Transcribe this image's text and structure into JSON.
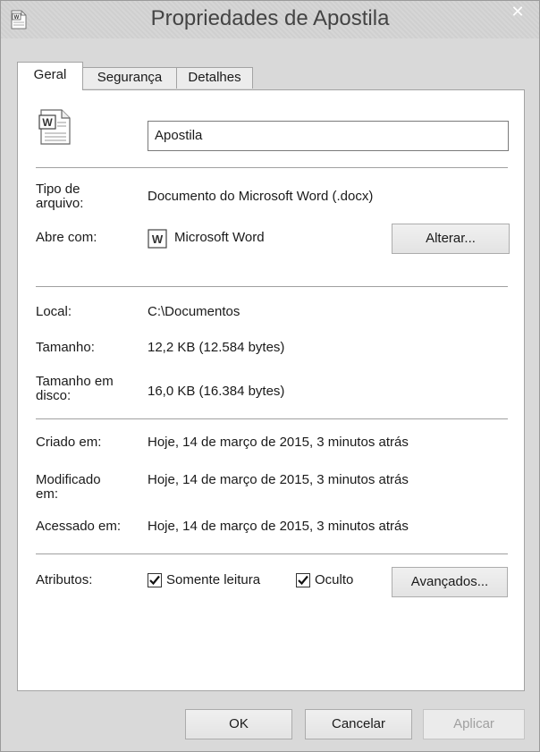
{
  "window": {
    "title": "Propriedades de Apostila",
    "close_glyph": "✕"
  },
  "tabs": [
    {
      "label": "Geral",
      "active": true
    },
    {
      "label": "Segurança",
      "active": false
    },
    {
      "label": "Detalhes",
      "active": false
    }
  ],
  "file": {
    "name": "Apostila",
    "icon": "word-document-icon"
  },
  "type_section": {
    "type_label": "Tipo de\narquivo:",
    "type_value": "Documento do Microsoft Word (.docx)",
    "opens_label": "Abre com:",
    "opens_value": "Microsoft Word",
    "change_button": "Alterar..."
  },
  "location_section": {
    "local_label": "Local:",
    "local_value": "C:\\Documentos",
    "size_label": "Tamanho:",
    "size_value": "12,2 KB (12.584 bytes)",
    "disk_size_label": "Tamanho em\ndisco:",
    "disk_size_value": "16,0 KB (16.384 bytes)"
  },
  "dates_section": {
    "created_label": "Criado em:",
    "created_value": "Hoje, 14 de março de 2015, 3 minutos atrás",
    "modified_label": "Modificado\nem:",
    "modified_value": "Hoje, 14 de março de 2015, 3 minutos atrás",
    "accessed_label": "Acessado em:",
    "accessed_value": "Hoje, 14 de março de 2015, 3 minutos atrás"
  },
  "attributes": {
    "label": "Atributos:",
    "readonly_label": "Somente leitura",
    "readonly_checked": true,
    "hidden_label": "Oculto",
    "hidden_checked": true,
    "advanced_button": "Avançados..."
  },
  "footer": {
    "ok": "OK",
    "cancel": "Cancelar",
    "apply": "Aplicar"
  },
  "colors": {
    "disabled_text": "#a0a0a0",
    "panel_bg": "#ffffff",
    "window_bg": "#d9d9d9"
  }
}
